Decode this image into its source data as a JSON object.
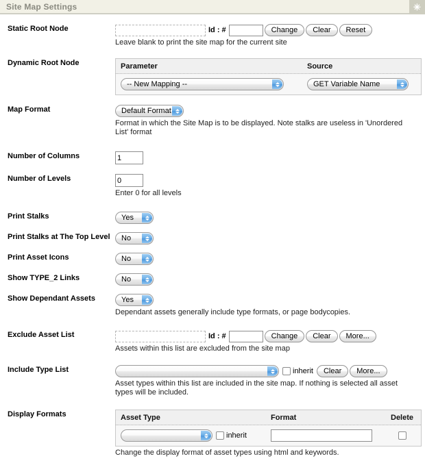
{
  "header": {
    "title": "Site Map Settings",
    "action_icon": "asterisk-icon",
    "action_glyph": "✳"
  },
  "labels": {
    "static_root_node": "Static Root Node",
    "dynamic_root_node": "Dynamic Root Node",
    "map_format": "Map Format",
    "number_of_columns": "Number of Columns",
    "number_of_levels": "Number of Levels",
    "print_stalks": "Print Stalks",
    "print_stalks_top_level": "Print Stalks at The Top Level",
    "print_asset_icons": "Print Asset Icons",
    "show_type2_links": "Show TYPE_2 Links",
    "show_dependant_assets": "Show Dependant Assets",
    "exclude_asset_list": "Exclude Asset List",
    "include_type_list": "Include Type List",
    "display_formats": "Display Formats"
  },
  "static_root_node": {
    "asset_value": "",
    "id_label": "Id : #",
    "id_value": "",
    "buttons": [
      "Change",
      "Clear",
      "Reset"
    ],
    "note": "Leave blank to print the site map for the current site"
  },
  "dynamic_root_node": {
    "columns": [
      "Parameter",
      "Source"
    ],
    "rows": [
      {
        "parameter": "-- New Mapping --",
        "source": "GET Variable Name"
      }
    ]
  },
  "map_format": {
    "value": "Default Format",
    "note": "Format in which the Site Map is to be displayed. Note stalks are useless in 'Unordered List' format"
  },
  "number_of_columns": {
    "value": "1"
  },
  "number_of_levels": {
    "value": "0",
    "note": "Enter 0 for all levels"
  },
  "print_stalks": {
    "value": "Yes"
  },
  "print_stalks_top_level": {
    "value": "No"
  },
  "print_asset_icons": {
    "value": "No"
  },
  "show_type2_links": {
    "value": "No"
  },
  "show_dependant_assets": {
    "value": "Yes",
    "note": "Dependant assets generally include type formats, or page bodycopies."
  },
  "exclude_asset_list": {
    "asset_value": "",
    "id_label": "Id : #",
    "id_value": "",
    "buttons": [
      "Change",
      "Clear",
      "More..."
    ],
    "note": "Assets within this list are excluded from the site map"
  },
  "include_type_list": {
    "value": "",
    "inherit_label": "inherit",
    "inherit_checked": false,
    "buttons": [
      "Clear",
      "More..."
    ],
    "note": "Asset types within this list are included in the site map. If nothing is selected all asset types will be included."
  },
  "display_formats": {
    "columns": [
      "Asset Type",
      "Format",
      "Delete"
    ],
    "rows": [
      {
        "asset_type": "",
        "inherit_label": "inherit",
        "format": "",
        "delete_checked": false
      }
    ],
    "note": "Change the display format of asset types using html and keywords."
  },
  "colors": {
    "header_bg": "#f2f1e6",
    "header_text": "#8a8a80",
    "header_button_bg": "#cdcdbf",
    "select_arrow_blue": "#4f9ade",
    "table_border": "#c8c8c8"
  }
}
